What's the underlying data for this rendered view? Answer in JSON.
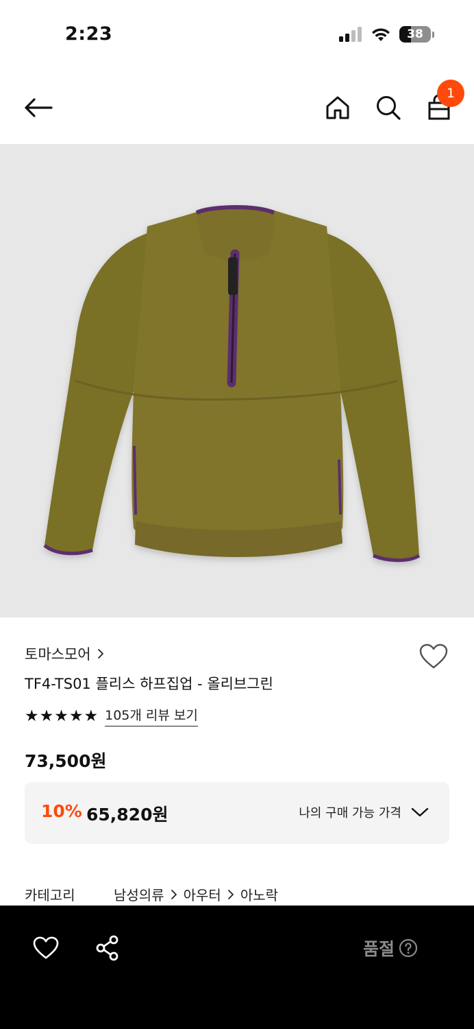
{
  "status_bar": {
    "time": "2:23",
    "battery": "38",
    "battery_level": 0.38
  },
  "header": {
    "cart_count": "1",
    "icons": [
      "back-arrow-icon",
      "home-icon",
      "search-icon",
      "shopping-bag-icon"
    ]
  },
  "product": {
    "image_alt": "olive fleece half-zip pullover",
    "brand": "토마스모어",
    "title": "TF4-TS01 플리스 하프집업 - 올리브그린",
    "rating": 5,
    "reviews_label": "105개 리뷰 보기",
    "price": "73,500원",
    "discount_rate": "10%",
    "discount_price": "65,820원",
    "my_price_label": "나의 구매 가능 가격"
  },
  "category": {
    "label": "카테고리",
    "path": [
      "남성의류",
      "아우터",
      "아노락"
    ]
  },
  "bottom_bar": {
    "status": "품절"
  },
  "colors": {
    "accent": "#ff4a0c",
    "fleece": "#7a7028",
    "trim": "#5b2f6e",
    "image_bg": "#e7e7e7"
  }
}
